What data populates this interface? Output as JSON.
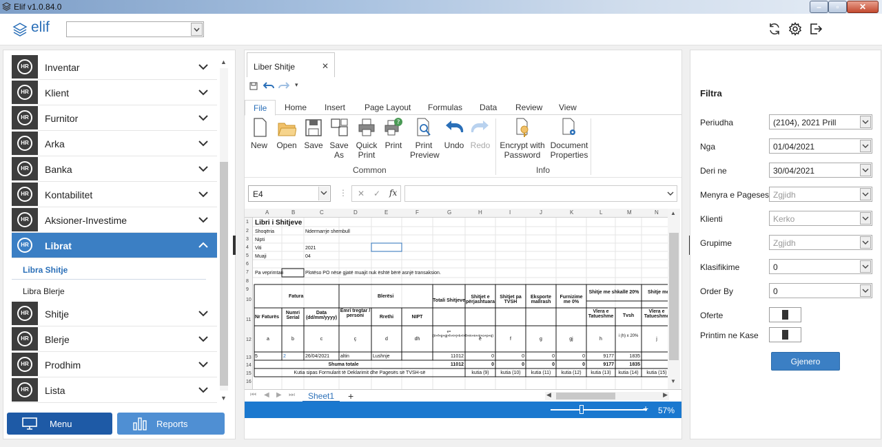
{
  "window": {
    "title": "Elif v1.0.84.0"
  },
  "header": {
    "logo": "elif",
    "combo_value": ""
  },
  "sidebar": {
    "items": [
      {
        "label": "Inventar",
        "badge": "HR"
      },
      {
        "label": "Klient",
        "badge": "HR"
      },
      {
        "label": "Furnitor",
        "badge": "HR"
      },
      {
        "label": "Arka",
        "badge": "HR"
      },
      {
        "label": "Banka",
        "badge": "HR"
      },
      {
        "label": "Kontabilitet",
        "badge": "HR"
      },
      {
        "label": "Aksioner-Investime",
        "badge": "HR"
      },
      {
        "label": "Librat",
        "badge": "HR",
        "active": true
      },
      {
        "label": "Shitje",
        "badge": "HR"
      },
      {
        "label": "Blerje",
        "badge": "HR"
      },
      {
        "label": "Prodhim",
        "badge": "HR"
      },
      {
        "label": "Lista",
        "badge": "HR"
      }
    ],
    "subitems": [
      {
        "label": "Libra Shitje",
        "selected": true
      },
      {
        "label": "Libra Blerje"
      }
    ],
    "menu_button": "Menu",
    "reports_button": "Reports"
  },
  "doc": {
    "tab_label": "Liber Shitje",
    "ribbon_tabs": [
      "File",
      "Home",
      "Insert",
      "Page Layout",
      "Formulas",
      "Data",
      "Review",
      "View"
    ],
    "buttons": {
      "new": "New",
      "open": "Open",
      "save": "Save",
      "save_as_1": "Save",
      "save_as_2": "As",
      "quick_1": "Quick",
      "quick_2": "Print",
      "print": "Print",
      "preview_1": "Print",
      "preview_2": "Preview",
      "undo": "Undo",
      "redo": "Redo",
      "encrypt_1": "Encrypt with",
      "encrypt_2": "Password",
      "props_1": "Document",
      "props_2": "Properties"
    },
    "groups": {
      "common": "Common",
      "info": "Info"
    },
    "name_box": "E4",
    "fx": "fx",
    "sheet_tab": "Sheet1",
    "zoom": "57%"
  },
  "sheet": {
    "columns": [
      "A",
      "B",
      "C",
      "D",
      "E",
      "F",
      "G",
      "H",
      "I",
      "J",
      "K",
      "L",
      "M",
      "N"
    ],
    "rows": [
      "1",
      "2",
      "3",
      "4",
      "5",
      "6",
      "7",
      "8",
      "9",
      "10",
      "11",
      "12",
      "13",
      "14",
      "15",
      "16"
    ],
    "title": "Libri i Shitjeve",
    "shoqeria_label": "Shoqëria",
    "shoqeria_value": "Ndermarrje shembull",
    "nipti_label": "Nipti",
    "viti_label": "Viti",
    "viti_value": "2021",
    "muaji_label": "Muaji",
    "muaji_value": "04",
    "pa_label": "Pa veprimtari",
    "pa_note": "Plotëso PO nëse gjatë muajit nuk është bërë asnjë transaksion.",
    "hdr_fatura": "Fatura",
    "hdr_bleresi": "Blerësi",
    "hdr_totali": "Totali Shitjeve",
    "hdr_perjashtuara": "Shitjet e përjashtuara",
    "hdr_patvsh": "Shitjet pa TVSH",
    "hdr_eksporte": "Eksporte mallrash",
    "hdr_furnizime": "Furnizime me 0%",
    "hdr_shkalle": "Shitje me shkallë 20%",
    "hdr_shitje_me": "Shitje me",
    "hdr_nr": "Nr Faturës",
    "hdr_numri": "Numri Serial",
    "hdr_data": "Data (dd/mm/yyyy)",
    "hdr_emri": "Emri tregtar / personi",
    "hdr_rrethi": "Rrethi",
    "hdr_nipt": "NIPT",
    "hdr_vlera": "Vlera e Tatueshme",
    "hdr_tvsh": "Tvsh",
    "hdr_vlera2": "Vlera e Tatueshme",
    "code_a": "a",
    "code_b": "b",
    "code_c": "c",
    "code_d1": "ç",
    "code_d": "d",
    "code_dh": "dh",
    "code_e": "ë",
    "code_f": "f",
    "code_g": "g",
    "code_gj": "gj",
    "code_h": "h",
    "code_i": "i (h) x 20%",
    "code_j": "j",
    "code_total": "e=(ë+f+g+gj+h+i+j+k+l+ll+m+n+nj+o+p+q)",
    "r13": {
      "a": "5",
      "b": "2",
      "c": "26/04/2021",
      "d": "altin",
      "f": "Lushnje",
      "g": "11012",
      "h": "0",
      "i": "0",
      "j": "0",
      "k": "0",
      "l": "9177",
      "m": "1835"
    },
    "r14": {
      "label": "Shuma totale",
      "g": "11012",
      "h": "0",
      "i": "0",
      "j": "0",
      "k": "0",
      "l": "9177",
      "m": "1835"
    },
    "r15": {
      "label": "Kutia sipas Formularit të Deklarimit dhe Pagesës së TVSH-së",
      "h": "kutia (9)",
      "i": "kutia (10)",
      "j": "kutia (11)",
      "k": "kutia (12)",
      "l": "kutia (13)",
      "m": "kutia (14)",
      "n": "kutia (15)"
    }
  },
  "filters": {
    "title": "Filtra",
    "rows": [
      {
        "label": "Periudha",
        "value": "(2104), 2021 Prill"
      },
      {
        "label": "Nga",
        "value": "01/04/2021"
      },
      {
        "label": "Deri ne",
        "value": "30/04/2021"
      },
      {
        "label": "Menyra e Pageses",
        "value": "Zgjidh"
      },
      {
        "label": "Klienti",
        "value": "Kerko"
      },
      {
        "label": "Grupime",
        "value": "Zgjidh"
      },
      {
        "label": "Klasifikime",
        "value": "0"
      },
      {
        "label": "Order By",
        "value": "0"
      }
    ],
    "oferte": "Oferte",
    "printim": "Printim ne Kase",
    "generate": "Gjenero"
  }
}
